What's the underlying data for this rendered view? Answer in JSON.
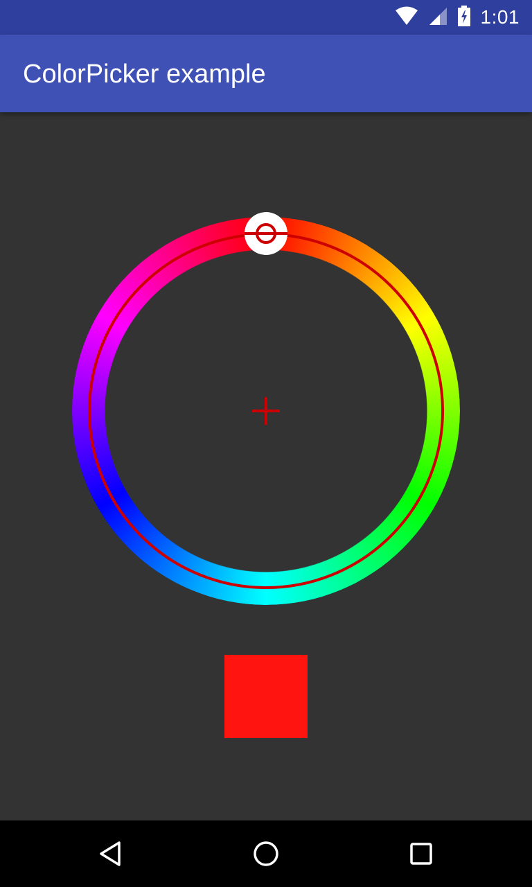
{
  "status_bar": {
    "time": "1:01",
    "icons": [
      "wifi-icon",
      "cell-signal-icon",
      "battery-charging-icon"
    ]
  },
  "app_bar": {
    "title": "ColorPicker example"
  },
  "picker": {
    "selected_color": "#ff1410",
    "ring_color": "#cc0000",
    "hue_degrees": 0
  },
  "nav": {
    "icons": [
      "back-icon",
      "home-icon",
      "recents-icon"
    ]
  }
}
